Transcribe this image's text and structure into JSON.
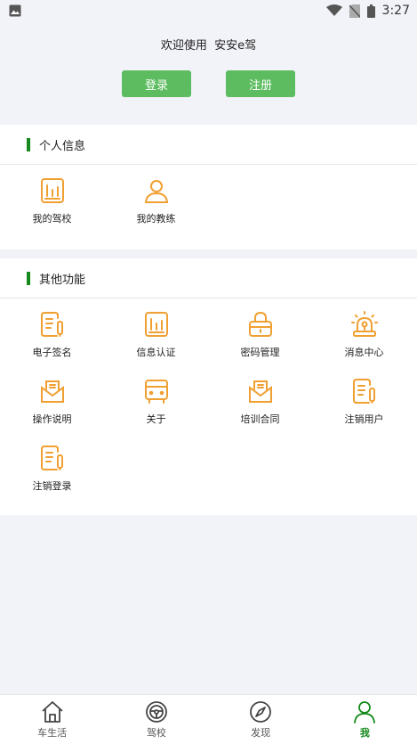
{
  "status_bar": {
    "time": "3:27"
  },
  "header": {
    "welcome": "欢迎使用  安安e驾",
    "login_label": "登录",
    "register_label": "注册"
  },
  "personal_section": {
    "title": "个人信息",
    "items": [
      {
        "label": "我的驾校",
        "icon": "chart-doc-icon"
      },
      {
        "label": "我的教练",
        "icon": "person-icon"
      }
    ]
  },
  "other_section": {
    "title": "其他功能",
    "items": [
      {
        "label": "电子签名",
        "icon": "document-pen-icon"
      },
      {
        "label": "信息认证",
        "icon": "chart-doc-icon"
      },
      {
        "label": "密码管理",
        "icon": "lock-icon"
      },
      {
        "label": "消息中心",
        "icon": "alarm-icon"
      },
      {
        "label": "操作说明",
        "icon": "mail-icon"
      },
      {
        "label": "关于",
        "icon": "bus-icon"
      },
      {
        "label": "培训合同",
        "icon": "mail-icon"
      },
      {
        "label": "注销用户",
        "icon": "document-pen-icon"
      },
      {
        "label": "注销登录",
        "icon": "document-pen-icon"
      }
    ]
  },
  "tabbar": {
    "items": [
      {
        "label": "车生活",
        "icon": "home-icon"
      },
      {
        "label": "驾校",
        "icon": "steering-wheel-icon"
      },
      {
        "label": "发现",
        "icon": "compass-icon"
      },
      {
        "label": "我",
        "icon": "user-icon",
        "active": true
      }
    ]
  },
  "colors": {
    "accent_green": "#14891c",
    "button_green": "#5cbc5f",
    "icon_orange": "#f0a032"
  }
}
